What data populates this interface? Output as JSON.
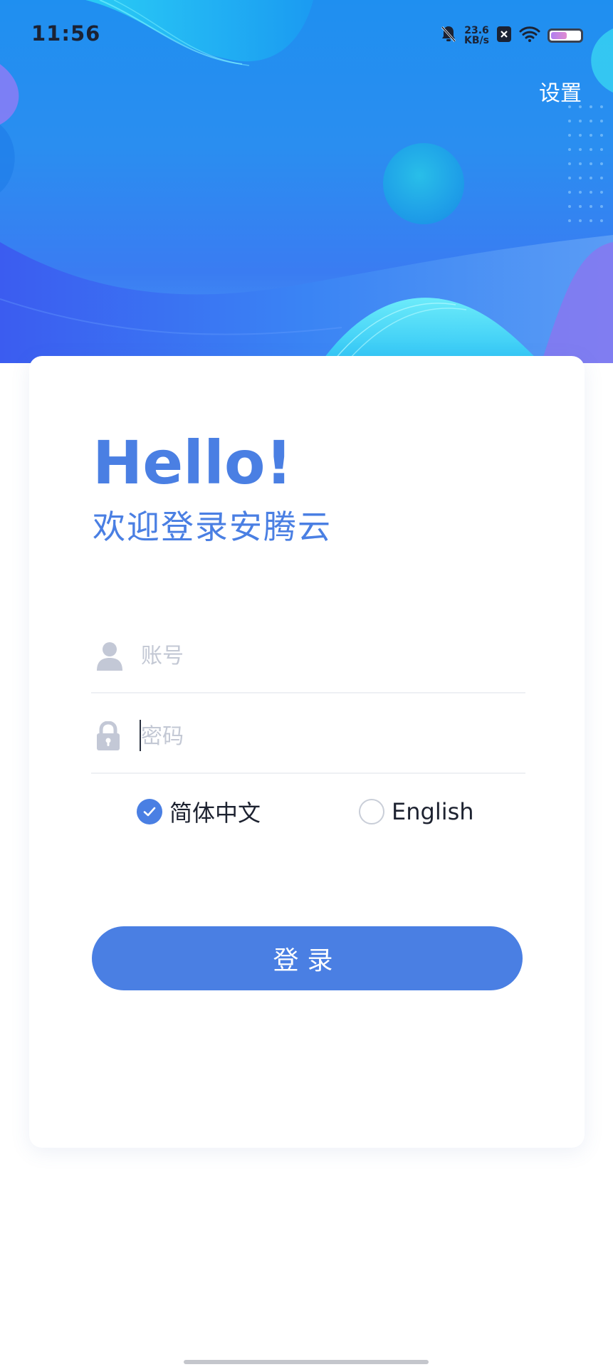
{
  "status_bar": {
    "time": "11:56",
    "net_speed_value": "23.6",
    "net_speed_unit": "KB/s",
    "icons": [
      "bell-muted-icon",
      "notification-x-icon",
      "wifi-icon",
      "battery-icon"
    ],
    "battery_level": 0.55
  },
  "header": {
    "settings_label": "设置"
  },
  "greeting": {
    "title": "Hello!",
    "subtitle": "欢迎登录安腾云"
  },
  "form": {
    "account_placeholder": "账号",
    "account_value": "",
    "password_placeholder": "密码",
    "password_value": ""
  },
  "language": {
    "options": [
      {
        "label": "简体中文",
        "selected": true
      },
      {
        "label": "English",
        "selected": false
      }
    ]
  },
  "login_button_label": "登录",
  "colors": {
    "accent": "#4a7fe3",
    "hero_blue": "#1f8ff0",
    "text_dark": "#1d2230",
    "placeholder": "#c3c8d4"
  }
}
